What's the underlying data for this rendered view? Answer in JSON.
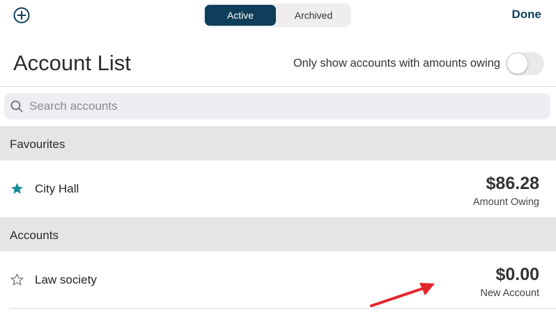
{
  "topbar": {
    "add_icon": "plus-circle-icon",
    "segments": [
      "Active",
      "Archived"
    ],
    "selected_segment": "Active",
    "done_label": "Done",
    "accent_color": "#0f3e5b"
  },
  "header": {
    "title": "Account List",
    "toggle_label": "Only show accounts with amounts owing",
    "toggle_on": false
  },
  "search": {
    "placeholder": "Search accounts",
    "value": "",
    "icon": "search-icon"
  },
  "sections": [
    {
      "title": "Favourites",
      "rows": [
        {
          "name": "City Hall",
          "amount": "$86.28",
          "status": "Amount Owing",
          "favourite": true,
          "star_color": "#1a8a96"
        }
      ]
    },
    {
      "title": "Accounts",
      "rows": [
        {
          "name": "Law society",
          "amount": "$0.00",
          "status": "New Account",
          "favourite": false
        }
      ]
    }
  ],
  "annotation": {
    "arrow_color": "#e3262b"
  }
}
